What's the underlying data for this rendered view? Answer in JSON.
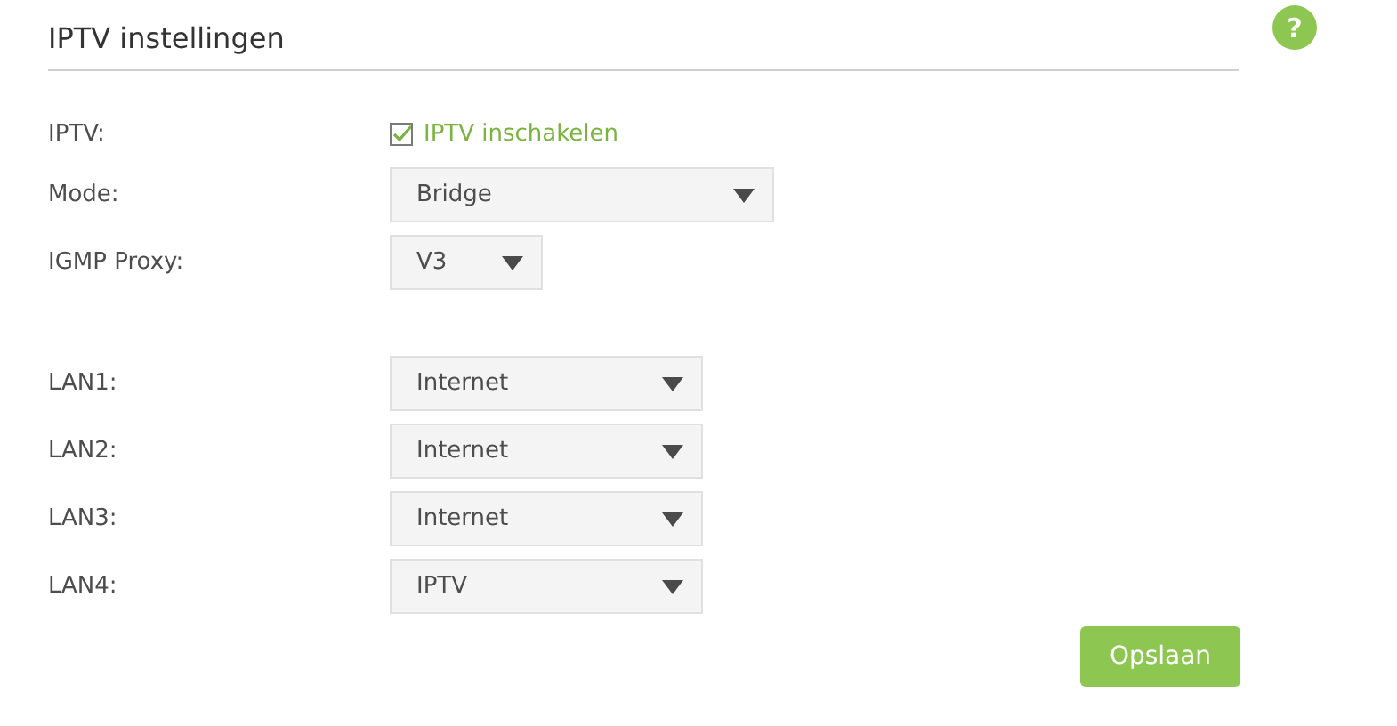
{
  "title": "IPTV instellingen",
  "help": {
    "symbol": "?"
  },
  "iptv": {
    "label": "IPTV:",
    "checkbox_label": "IPTV inschakelen",
    "checked": true
  },
  "mode": {
    "label": "Mode:",
    "value": "Bridge"
  },
  "igmp_proxy": {
    "label": "IGMP Proxy:",
    "value": "V3"
  },
  "lan_ports": [
    {
      "label": "LAN1:",
      "value": "Internet"
    },
    {
      "label": "LAN2:",
      "value": "Internet"
    },
    {
      "label": "LAN3:",
      "value": "Internet"
    },
    {
      "label": "LAN4:",
      "value": "IPTV"
    }
  ],
  "save_button": "Opslaan"
}
